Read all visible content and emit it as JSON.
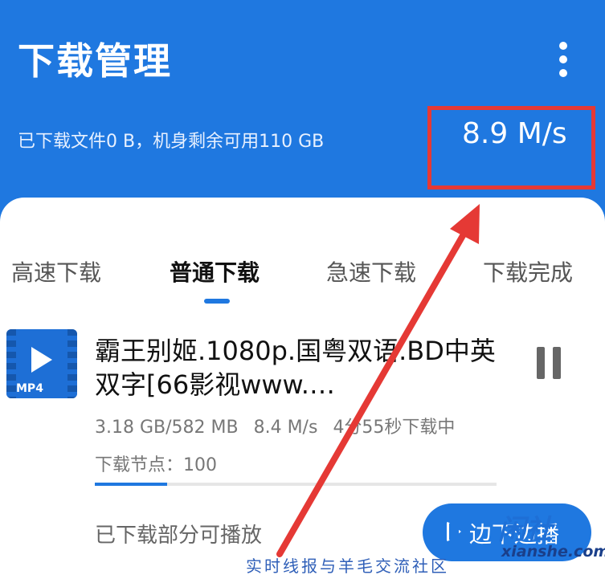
{
  "header": {
    "title": "下载管理",
    "storage_text": "已下载文件0 B，机身剩余可用110 GB",
    "speed": "8.9 M/s",
    "more_icon": "more-vertical-icon"
  },
  "tabs": [
    {
      "label": "高速下载",
      "active": false
    },
    {
      "label": "普通下载",
      "active": true
    },
    {
      "label": "急速下载",
      "active": false
    },
    {
      "label": "下载完成",
      "active": false
    }
  ],
  "download_item": {
    "file_type": "MP4",
    "file_icon": "video-file-icon",
    "name": "霸王别姬.1080p.国粤双语.BD中英双字[66影视www.…",
    "size_total": "3.18 GB/582 MB",
    "speed": "8.4 M/s",
    "time_left": "4分55秒下载中",
    "node_text": "下载节点：100",
    "progress_fraction": 0.18,
    "pause_icon": "pause-icon",
    "partial_text": "已下载部分可播放",
    "play_button_label": "边下边播",
    "play_icon": "play-icon"
  },
  "watermark": {
    "logo": "闲社",
    "site": "xianshe.com",
    "tagline": "实时线报与羊毛交流社区"
  },
  "colors": {
    "accent": "#1f78e0",
    "highlight": "#e53935"
  }
}
